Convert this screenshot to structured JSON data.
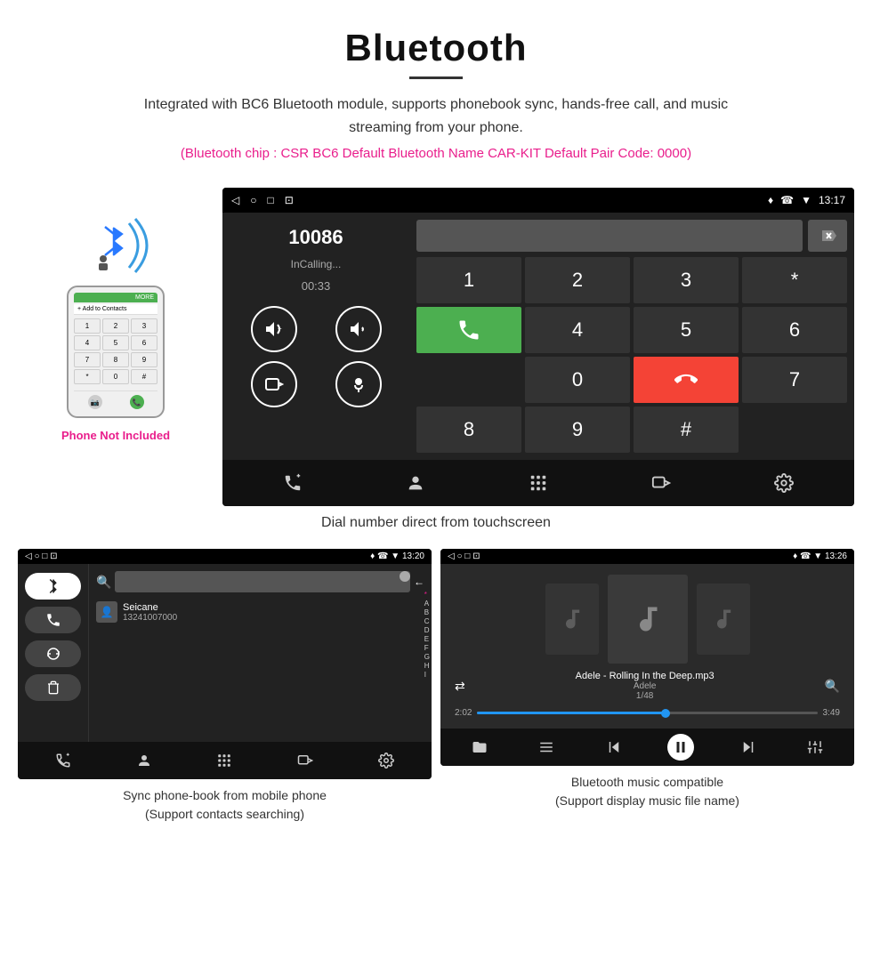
{
  "header": {
    "title": "Bluetooth",
    "description": "Integrated with BC6 Bluetooth module, supports phonebook sync, hands-free call, and music streaming from your phone.",
    "specs": "(Bluetooth chip : CSR BC6    Default Bluetooth Name CAR-KIT    Default Pair Code: 0000)"
  },
  "phone_side": {
    "not_included": "Phone Not Included"
  },
  "car_screen": {
    "status_bar": {
      "nav_icons": [
        "◁",
        "○",
        "□",
        "⊡"
      ],
      "right_icons": "♦ ☎ ▼ 13:17"
    },
    "dial_number": "10086",
    "dial_status": "InCalling...",
    "dial_timer": "00:33",
    "numpad": [
      "1",
      "2",
      "3",
      "*",
      "4",
      "5",
      "6",
      "0",
      "7",
      "8",
      "9",
      "#"
    ],
    "caption": "Dial number direct from touchscreen"
  },
  "phonebook_screen": {
    "status_right": "♦ ☎ ▼ 13:20",
    "contact_name": "Seicane",
    "contact_number": "13241007000",
    "letters": [
      "*",
      "A",
      "B",
      "C",
      "D",
      "E",
      "F",
      "G",
      "H",
      "I"
    ],
    "caption_line1": "Sync phone-book from mobile phone",
    "caption_line2": "(Support contacts searching)"
  },
  "music_screen": {
    "status_right": "♦ ☎ ▼ 13:26",
    "song_title": "Adele - Rolling In the Deep.mp3",
    "artist": "Adele",
    "counter": "1/48",
    "time_current": "2:02",
    "time_total": "3:49",
    "caption_line1": "Bluetooth music compatible",
    "caption_line2": "(Support display music file name)"
  },
  "colors": {
    "accent_pink": "#e91e8c",
    "accent_green": "#4caf50",
    "accent_red": "#f44336",
    "accent_blue": "#2196f3",
    "dark_bg": "#1a1a1a",
    "medium_bg": "#2a2a2a"
  }
}
